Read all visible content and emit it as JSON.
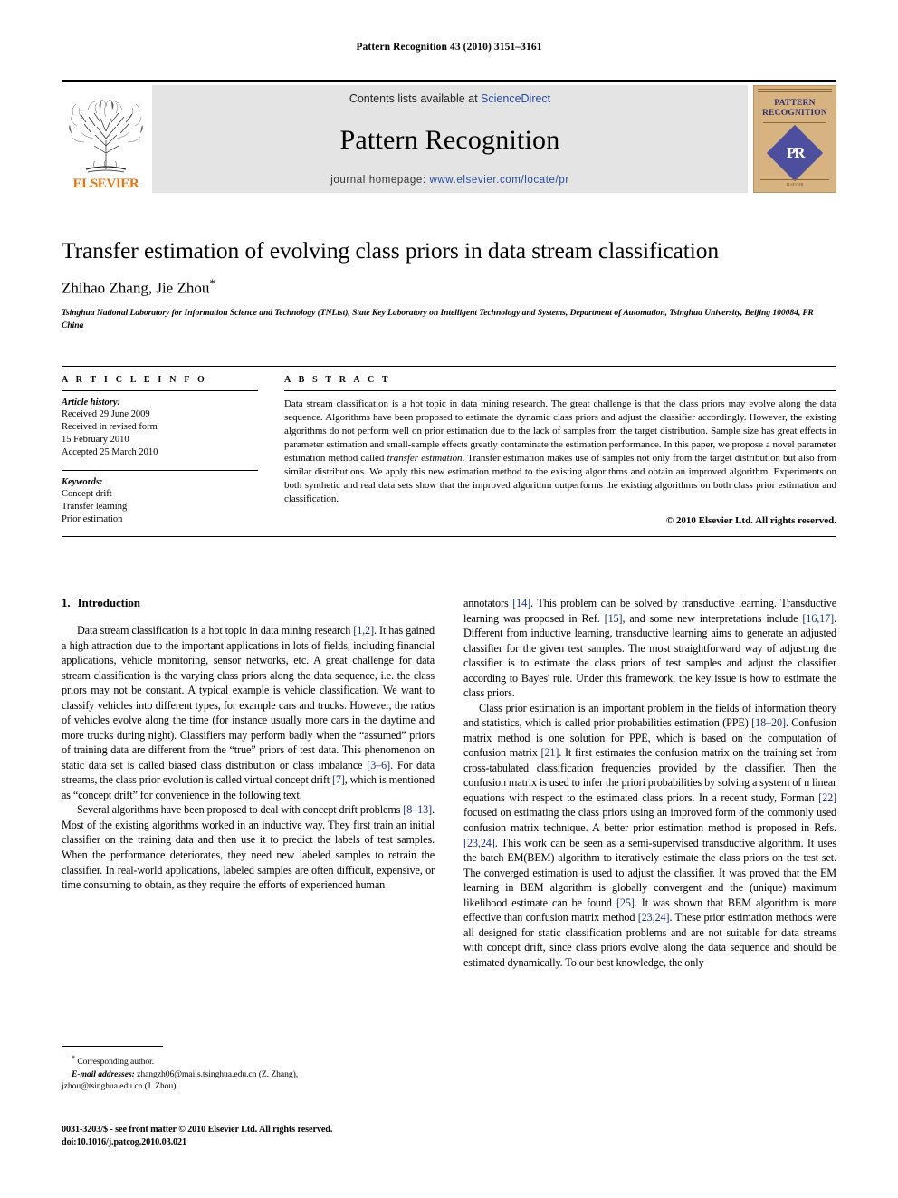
{
  "running_head": "Pattern Recognition 43 (2010) 3151–3161",
  "masthead": {
    "publisher_name": "ELSEVIER",
    "contents_prefix": "Contents lists available at ",
    "contents_link": "ScienceDirect",
    "journal_title": "Pattern Recognition",
    "homepage_prefix": "journal homepage: ",
    "homepage_url": "www.elsevier.com/locate/pr",
    "cover": {
      "title_line1": "PATTERN",
      "title_line2": "RECOGNITION",
      "monogram": "PR",
      "footer": "ELSEVIER"
    }
  },
  "article": {
    "title": "Transfer estimation of evolving class priors in data stream classification",
    "authors": "Zhihao Zhang, Jie Zhou",
    "corresponding_marker": "*",
    "affiliation": "Tsinghua National Laboratory for Information Science and Technology (TNList), State Key Laboratory on Intelligent Technology and Systems, Department of Automation, Tsinghua University, Beijing 100084, PR China"
  },
  "article_info": {
    "heading": "A R T I C L E   I N F O",
    "history_label": "Article history:",
    "history_lines": [
      "Received 29 June 2009",
      "Received in revised form",
      "15 February 2010",
      "Accepted 25 March 2010"
    ],
    "keywords_label": "Keywords:",
    "keywords": [
      "Concept drift",
      "Transfer learning",
      "Prior estimation"
    ]
  },
  "abstract": {
    "heading": "A B S T R A C T",
    "part1": "Data stream classification is a hot topic in data mining research. The great challenge is that the class priors may evolve along the data sequence. Algorithms have been proposed to estimate the dynamic class priors and adjust the classifier accordingly. However, the existing algorithms do not perform well on prior estimation due to the lack of samples from the target distribution. Sample size has great effects in parameter estimation and small-sample effects greatly contaminate the estimation performance. In this paper, we propose a novel parameter estimation method called ",
    "italic_term": "transfer estimation",
    "part2": ". Transfer estimation makes use of samples not only from the target distribution but also from similar distributions. We apply this new estimation method to the existing algorithms and obtain an improved algorithm. Experiments on both synthetic and real data sets show that the improved algorithm outperforms the existing algorithms on both class prior estimation and classification.",
    "copyright": "© 2010 Elsevier Ltd. All rights reserved."
  },
  "body": {
    "section_number": "1.",
    "section_name": "Introduction",
    "left_p1_a": "Data stream classification is a hot topic in data mining research ",
    "left_p1_r1": "[1,2]",
    "left_p1_b": ". It has gained a high attraction due to the important applications in lots of fields, including financial applications, vehicle monitoring, sensor networks, etc. A great challenge for data stream classification is the varying class priors along the data sequence, i.e. the class priors may not be constant. A typical example is vehicle classification. We want to classify vehicles into different types, for example cars and trucks. However, the ratios of vehicles evolve along the time (for instance usually more cars in the daytime and more trucks during night). Classifiers may perform badly when the “assumed” priors of training data are different from the “true” priors of test data. This phenomenon on static data set is called biased class distribution or class imbalance ",
    "left_p1_r2": "[3–6]",
    "left_p1_c": ". For data streams, the class prior evolution is called virtual concept drift ",
    "left_p1_r3": "[7]",
    "left_p1_d": ", which is mentioned as “concept drift” for convenience in the following text.",
    "left_p2_a": "Several algorithms have been proposed to deal with concept drift problems ",
    "left_p2_r1": "[8–13]",
    "left_p2_b": ". Most of the existing algorithms worked in an inductive way. They first train an initial classifier on the training data and then use it to predict the labels of test samples. When the performance deteriorates, they need new labeled samples to retrain the classifier. In real-world applications, labeled samples are often difficult, expensive, or time consuming to obtain, as they require the efforts of experienced human",
    "right_p1_a": "annotators ",
    "right_p1_r1": "[14]",
    "right_p1_b": ". This problem can be solved by transductive learning. Transductive learning was proposed in Ref. ",
    "right_p1_r2": "[15]",
    "right_p1_c": ", and some new interpretations include ",
    "right_p1_r3": "[16,17]",
    "right_p1_d": ". Different from inductive learning, transductive learning aims to generate an adjusted classifier for the given test samples. The most straightforward way of adjusting the classifier is to estimate the class priors of test samples and adjust the classifier according to Bayes' rule. Under this framework, the key issue is how to estimate the class priors.",
    "right_p2_a": "Class prior estimation is an important problem in the fields of information theory and statistics, which is called prior probabilities estimation (PPE) ",
    "right_p2_r1": "[18–20]",
    "right_p2_b": ". Confusion matrix method is one solution for PPE, which is based on the computation of confusion matrix ",
    "right_p2_r2": "[21]",
    "right_p2_c": ". It first estimates the confusion matrix on the training set from cross-tabulated classification frequencies provided by the classifier. Then the confusion matrix is used to infer the priori probabilities by solving a system of n linear equations with respect to the estimated class priors. In a recent study, Forman ",
    "right_p2_r3": "[22]",
    "right_p2_d": " focused on estimating the class priors using an improved form of the commonly used confusion matrix technique. A better prior estimation method is proposed in Refs. ",
    "right_p2_r4": "[23,24]",
    "right_p2_e": ". This work can be seen as a semi-supervised transductive algorithm. It uses the batch EM(BEM) algorithm to iteratively estimate the class priors on the test set. The converged estimation is used to adjust the classifier. It was proved that the EM learning in BEM algorithm is globally convergent and the (unique) maximum likelihood estimate can be found ",
    "right_p2_r5": "[25]",
    "right_p2_f": ". It was shown that BEM algorithm is more effective than confusion matrix method ",
    "right_p2_r6": "[23,24]",
    "right_p2_g": ". These prior estimation methods were all designed for static classification problems and are not suitable for data streams with concept drift, since class priors evolve along the data sequence and should be estimated dynamically. To our best knowledge, the only"
  },
  "footnote": {
    "corresponding": "Corresponding author.",
    "email_label": "E-mail addresses:",
    "email_line1": " zhangzh06@mails.tsinghua.edu.cn (Z. Zhang),",
    "email_line2": "jzhou@tsinghua.edu.cn (J. Zhou)."
  },
  "imprint": {
    "line1": "0031-3203/$ - see front matter © 2010 Elsevier Ltd. All rights reserved.",
    "line2": "doi:10.1016/j.patcog.2010.03.021"
  },
  "colors": {
    "link": "#2a4ba0",
    "reference": "#1b2f7a",
    "elsevier_orange": "#E8720C",
    "masthead_grey": "#e4e4e4",
    "cover_tan": "#d8b382",
    "cover_blue": "#4d4f9e"
  }
}
